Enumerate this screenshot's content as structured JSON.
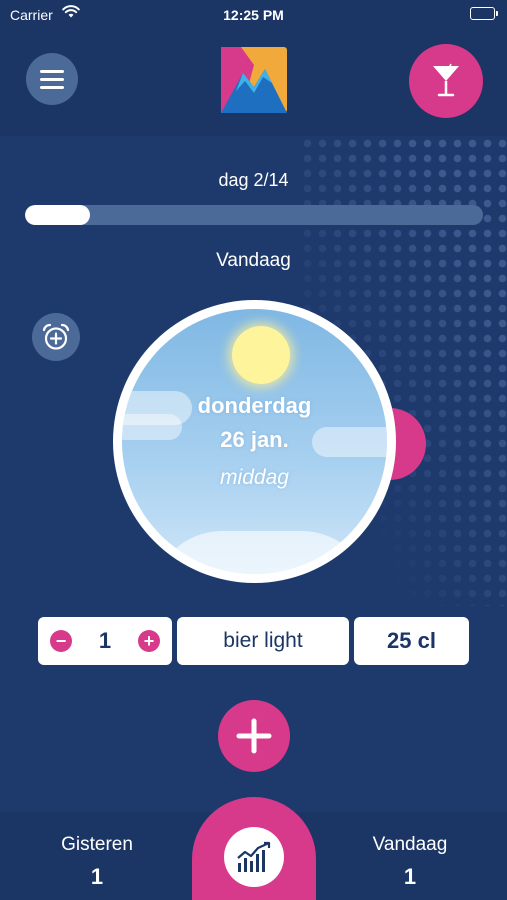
{
  "status_bar": {
    "carrier": "Carrier",
    "time": "12:25 PM"
  },
  "header": {
    "menu_icon": "hamburger-menu-icon",
    "logo_icon": "mountain-logo-icon",
    "drink_icon": "cocktail-glass-icon"
  },
  "progress": {
    "label": "dag 2/14",
    "fraction": 0.143
  },
  "day_title": "Vandaag",
  "alarm_icon": "alarm-clock-add-icon",
  "dial": {
    "weekday": "donderdag",
    "date": "26 jan.",
    "part_of_day": "middag"
  },
  "entry": {
    "quantity": "1",
    "minus": "−",
    "plus": "+",
    "drink": "bier light",
    "size": "25 cl"
  },
  "add_icon": "plus-icon",
  "bottom": {
    "yesterday_label": "Gisteren",
    "yesterday_count": "1",
    "today_label": "Vandaag",
    "today_count": "1",
    "stats_icon": "chart-icon"
  },
  "colors": {
    "background": "#1e3a6d",
    "accent": "#d83a8b",
    "muted": "#4b6a98"
  }
}
